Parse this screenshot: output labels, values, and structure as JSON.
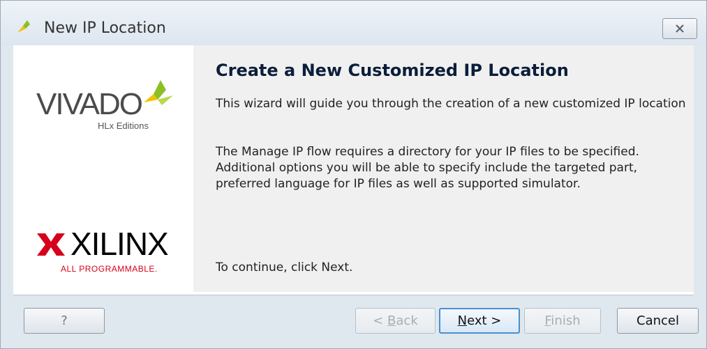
{
  "window": {
    "title": "New IP Location",
    "close_label": "Close"
  },
  "sidebar": {
    "vivado_logo": {
      "name": "VIVADO",
      "subtitle": "HLx Editions"
    },
    "xilinx_logo": {
      "name": "XILINX",
      "tagline_prefix": "ALL PROGRAMMABLE",
      "tagline_suffix": "."
    }
  },
  "main": {
    "heading": "Create a New Customized IP Location",
    "paragraph1": "This wizard will guide you through the creation of a new customized IP location",
    "paragraph2": "The Manage IP flow requires a directory for your IP files to be specified. Additional options you will be able to specify include the targeted part, preferred language for IP files as well as supported simulator.",
    "continue_text": "To continue, click Next."
  },
  "buttons": {
    "help": "?",
    "back_prefix": "< ",
    "back_mnemonic": "B",
    "back_rest": "ack",
    "next_mnemonic": "N",
    "next_rest": "ext >",
    "finish_mnemonic": "F",
    "finish_rest": "inish",
    "cancel": "Cancel"
  },
  "colors": {
    "accent_leaf": "#8cbf26",
    "xilinx_red": "#d6001c",
    "heading": "#0b1e3a"
  },
  "icons": {
    "title": "vivado-leaf-icon",
    "close": "close-x-icon"
  }
}
